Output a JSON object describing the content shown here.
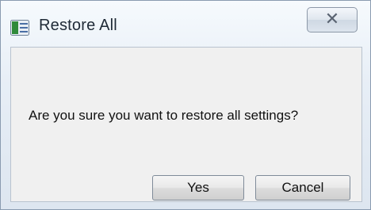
{
  "window": {
    "title": "Restore All",
    "close_glyph": "✕"
  },
  "dialog": {
    "message": "Are you sure you want to restore all settings?",
    "buttons": {
      "yes_label": "Yes",
      "cancel_label": "Cancel"
    }
  },
  "icons": {
    "app": "app-window-icon",
    "close": "close-icon"
  },
  "colors": {
    "titlebar_gradient_top": "#f6fafd",
    "client_background": "#f0f0f0",
    "border": "#8a9bb0"
  }
}
